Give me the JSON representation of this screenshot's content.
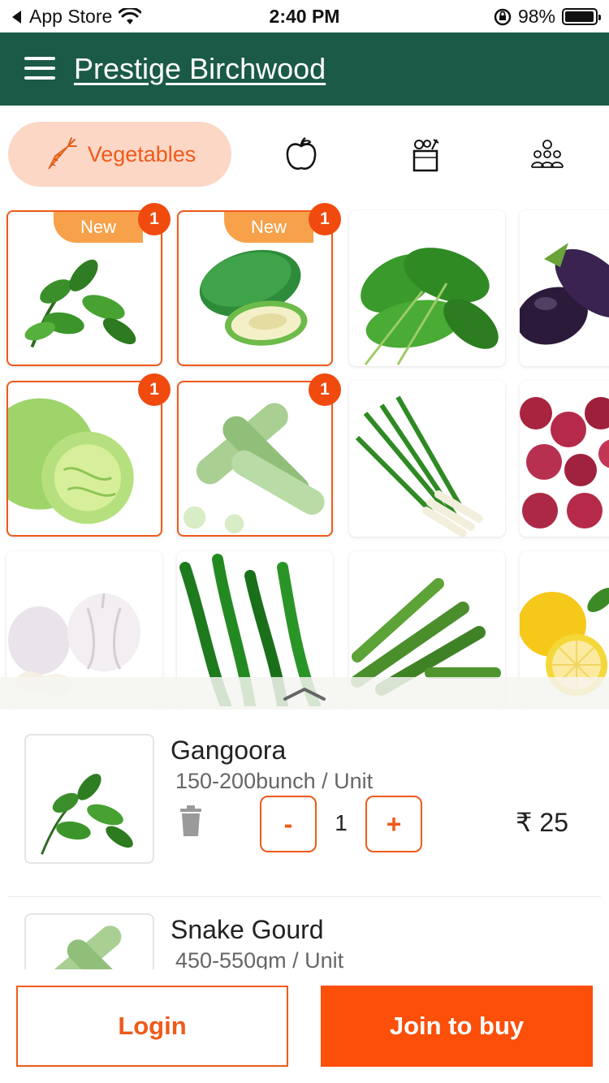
{
  "status_bar": {
    "back_app": "App Store",
    "time": "2:40 PM",
    "battery": "98%",
    "battery_level": 0.98
  },
  "header": {
    "title": "Prestige Birchwood"
  },
  "categories": {
    "active_label": "Vegetables",
    "items": [
      {
        "icon": "carrot-icon",
        "label": "Vegetables",
        "active": true
      },
      {
        "icon": "apple-icon",
        "active": false
      },
      {
        "icon": "grocery-box-icon",
        "active": false
      },
      {
        "icon": "people-icon",
        "active": false
      }
    ]
  },
  "products": [
    {
      "icon": "gangoora-leaves",
      "new_label": "New",
      "count": "1",
      "selected": true
    },
    {
      "icon": "raw-papaya",
      "new_label": "New",
      "count": "1",
      "selected": true
    },
    {
      "icon": "spinach-leaves",
      "selected": false
    },
    {
      "icon": "brinjal",
      "selected": false
    },
    {
      "icon": "cabbage",
      "count": "1",
      "selected": true
    },
    {
      "icon": "snake-gourd",
      "count": "1",
      "selected": true
    },
    {
      "icon": "spring-onion",
      "selected": false
    },
    {
      "icon": "red-onion",
      "selected": false
    },
    {
      "icon": "garlic",
      "selected": false
    },
    {
      "icon": "green-chilli",
      "selected": false
    },
    {
      "icon": "okra",
      "selected": false
    },
    {
      "icon": "lemon",
      "selected": false
    }
  ],
  "cart": {
    "items": [
      {
        "name": "Gangoora",
        "unit": "150-200bunch / Unit",
        "quantity": "1",
        "price": "₹ 25",
        "minus": "-",
        "plus": "+"
      },
      {
        "name": "Snake Gourd",
        "unit": "450-550gm / Unit"
      }
    ]
  },
  "footer": {
    "login_label": "Login",
    "join_label": "Join to buy"
  },
  "colors": {
    "header_bg": "#1b5a47",
    "accent": "#f05a1a",
    "badge_new": "#f7a14a",
    "active_tab_bg": "#fdd7c6"
  }
}
